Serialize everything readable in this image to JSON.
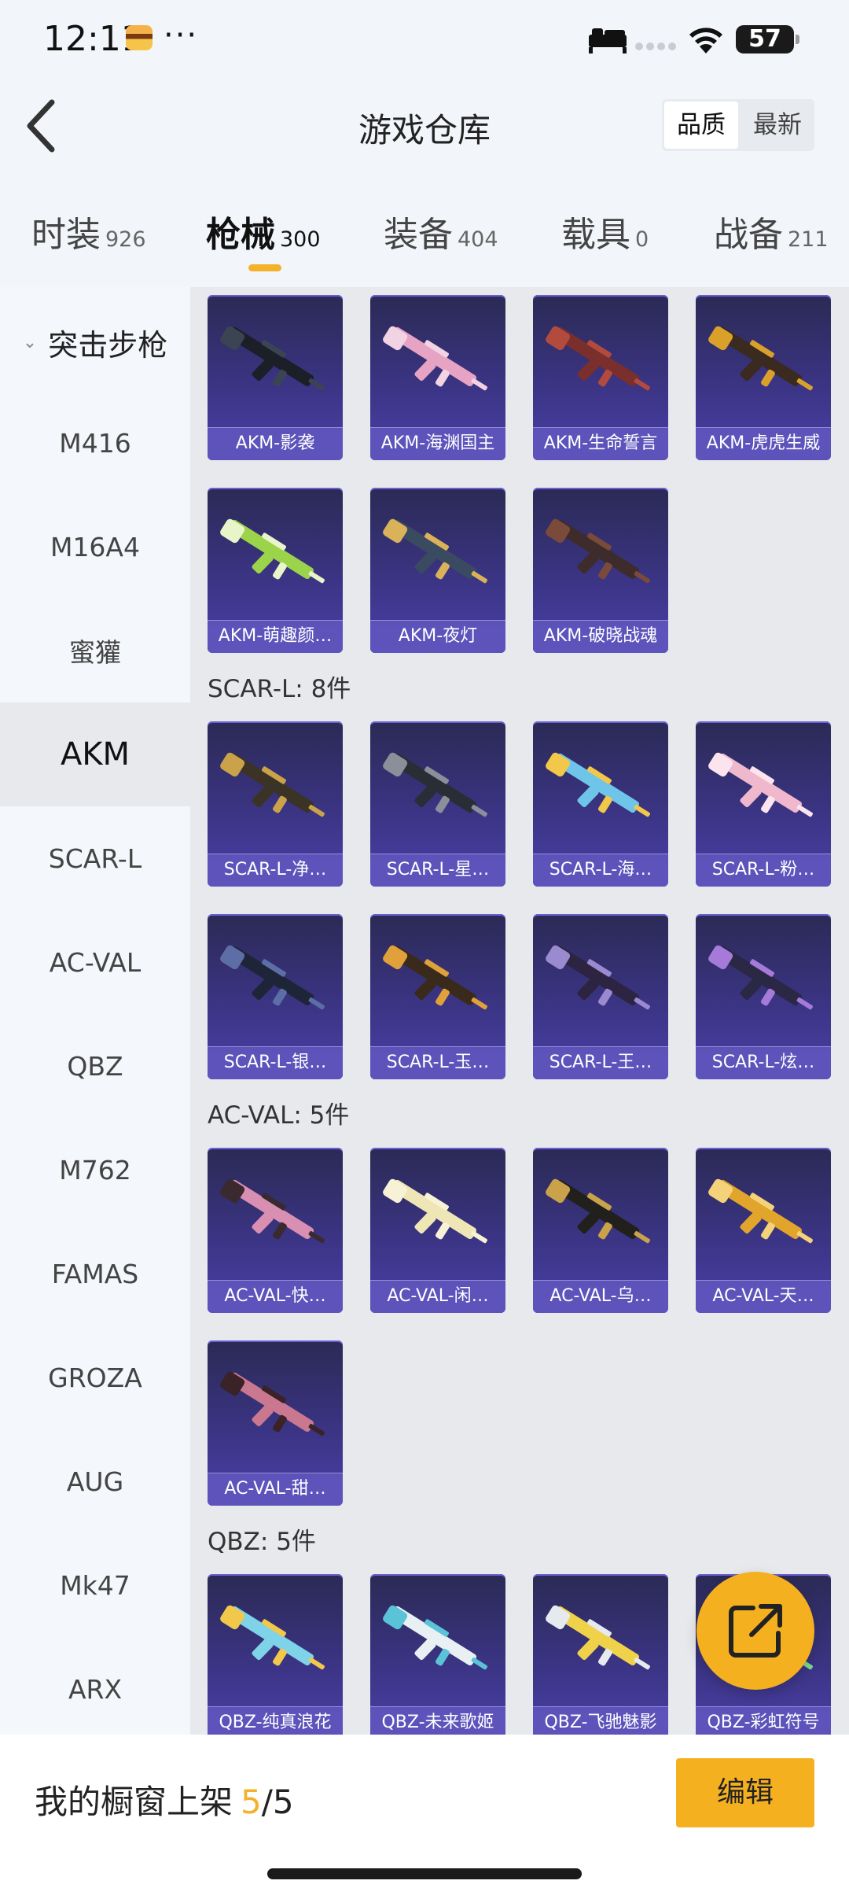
{
  "status_bar": {
    "time": "12:11",
    "more": "···",
    "battery": "57"
  },
  "header": {
    "title": "游戏仓库",
    "sort_options": [
      "品质",
      "最新"
    ],
    "sort_selected": "品质"
  },
  "tabs": [
    {
      "name": "时装",
      "count": "926",
      "active": false
    },
    {
      "name": "枪械",
      "count": "300",
      "active": true
    },
    {
      "name": "装备",
      "count": "404",
      "active": false
    },
    {
      "name": "载具",
      "count": "0",
      "active": false
    },
    {
      "name": "战备",
      "count": "211",
      "active": false
    }
  ],
  "sidebar": {
    "group": "突击步枪",
    "items": [
      "M416",
      "M16A4",
      "蜜獾",
      "AKM",
      "SCAR-L",
      "AC-VAL",
      "QBZ",
      "M762",
      "FAMAS",
      "GROZA",
      "AUG",
      "Mk47",
      "ARX"
    ],
    "active": "AKM"
  },
  "sections": {
    "akm": {
      "items": [
        {
          "name": "AKM-影袭",
          "color": "#1c1f28",
          "accent": "#3b4452"
        },
        {
          "name": "AKM-海渊国主",
          "color": "#e6a3c4",
          "accent": "#f2d3e3"
        },
        {
          "name": "AKM-生命誓言",
          "color": "#7a2f2c",
          "accent": "#b24a3d"
        },
        {
          "name": "AKM-虎虎生威",
          "color": "#3a2a20",
          "accent": "#d9a12a"
        },
        {
          "name": "AKM-萌趣颜…",
          "color": "#9bd34b",
          "accent": "#e9f5c9"
        },
        {
          "name": "AKM-夜灯",
          "color": "#3a4a60",
          "accent": "#d9b25a"
        },
        {
          "name": "AKM-破晓战魂",
          "color": "#3e2c2c",
          "accent": "#7a4a3a"
        }
      ]
    },
    "scar": {
      "title": "SCAR-L: 8件",
      "items": [
        {
          "name": "SCAR-L-净…",
          "color": "#3a3326",
          "accent": "#c9a24a"
        },
        {
          "name": "SCAR-L-星…",
          "color": "#2a2d35",
          "accent": "#8b8f9a"
        },
        {
          "name": "SCAR-L-海…",
          "color": "#6fc4ea",
          "accent": "#f2c84a"
        },
        {
          "name": "SCAR-L-粉…",
          "color": "#f0b8cd",
          "accent": "#fbe4ee"
        },
        {
          "name": "SCAR-L-银…",
          "color": "#1f2538",
          "accent": "#5c6ea5"
        },
        {
          "name": "SCAR-L-玉…",
          "color": "#3a2a1c",
          "accent": "#e0a03a"
        },
        {
          "name": "SCAR-L-王…",
          "color": "#2c2440",
          "accent": "#9a8ad0"
        },
        {
          "name": "SCAR-L-炫…",
          "color": "#2a2844",
          "accent": "#a57ad8"
        }
      ]
    },
    "acval": {
      "title": "AC-VAL: 5件",
      "items": [
        {
          "name": "AC-VAL-快…",
          "color": "#d98fb2",
          "accent": "#3a2a30"
        },
        {
          "name": "AC-VAL-闲…",
          "color": "#efe6b5",
          "accent": "#f7f1d6"
        },
        {
          "name": "AC-VAL-乌…",
          "color": "#22201c",
          "accent": "#c9a24a"
        },
        {
          "name": "AC-VAL-天…",
          "color": "#e2a52c",
          "accent": "#f4d27a"
        },
        {
          "name": "AC-VAL-甜…",
          "color": "#c9788f",
          "accent": "#3a2226"
        }
      ]
    },
    "qbz": {
      "title": "QBZ: 5件",
      "items": [
        {
          "name": "QBZ-纯真浪花",
          "color": "#7fd3e8",
          "accent": "#f2c84a"
        },
        {
          "name": "QBZ-未来歌姬",
          "color": "#e8f0f4",
          "accent": "#5bc3d8"
        },
        {
          "name": "QBZ-飞驰魅影",
          "color": "#f0d24a",
          "accent": "#e6e9ee"
        },
        {
          "name": "QBZ-彩虹符号",
          "color": "#3a6fd6",
          "accent": "#7adb8a"
        }
      ]
    }
  },
  "footer": {
    "label": "我的橱窗上架",
    "current": "5",
    "sep": "/",
    "total": "5",
    "edit_label": "编辑"
  },
  "colors": {
    "accent": "#f5b01f",
    "card_top": "#2b2a55",
    "card_bottom": "#4a40a8"
  }
}
